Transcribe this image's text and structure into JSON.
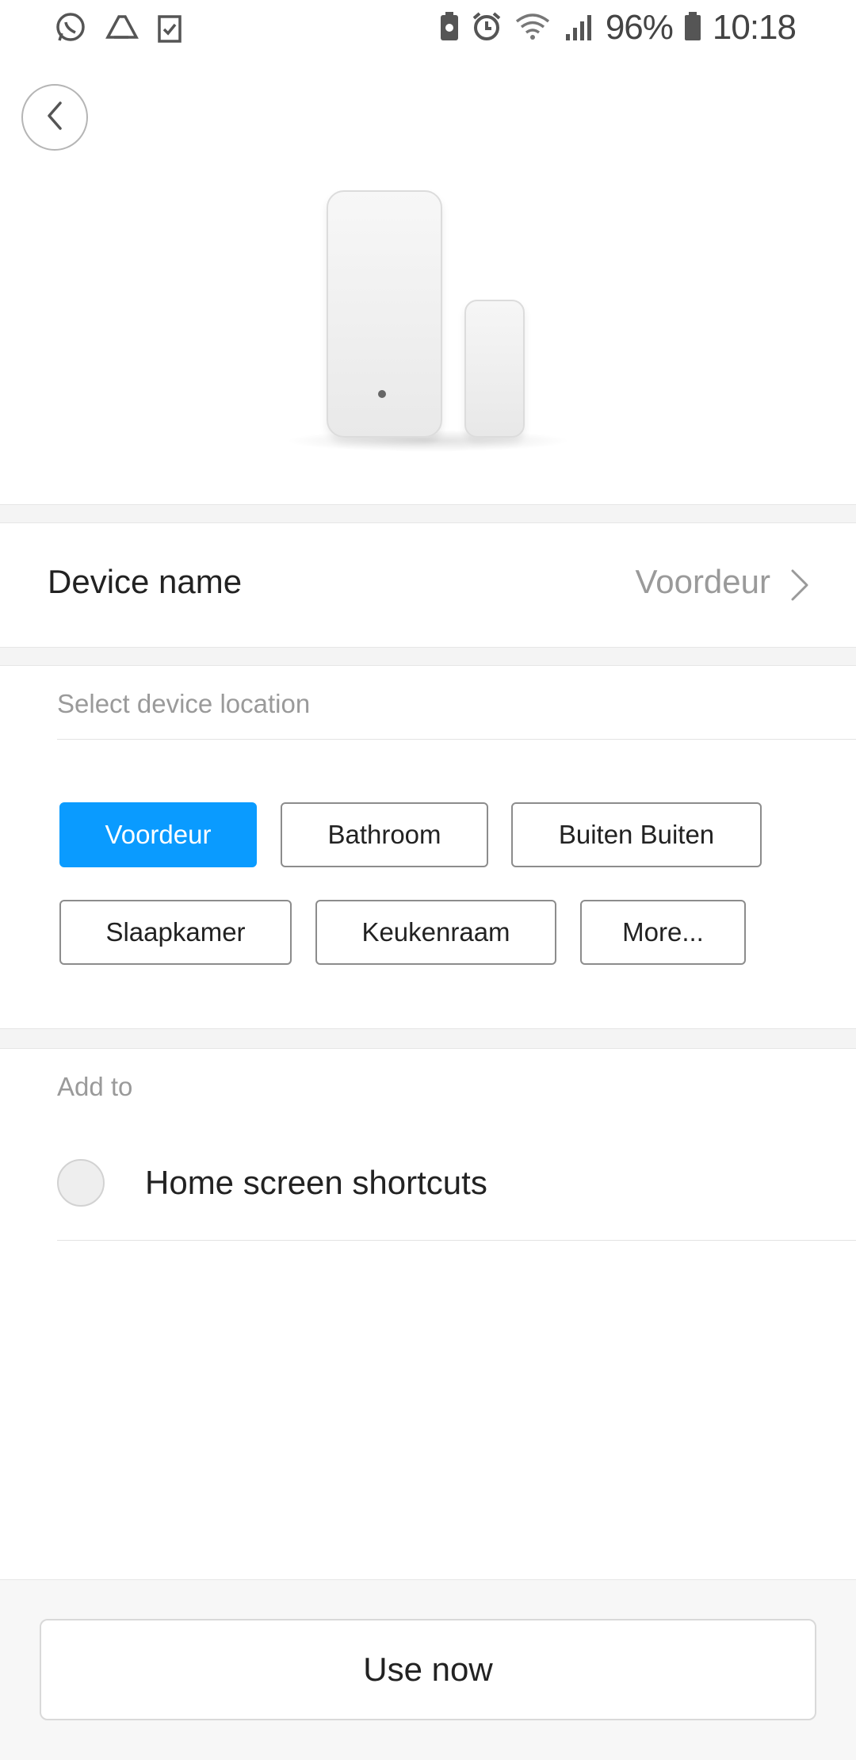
{
  "status_bar": {
    "battery": "96%",
    "time": "10:18",
    "left_icons": [
      "whatsapp-icon",
      "drive-icon",
      "clipboard-check-icon"
    ],
    "right_icons": [
      "battery-saver-icon",
      "alarm-icon",
      "wifi-icon",
      "signal-icon",
      "battery-icon"
    ]
  },
  "header": {
    "back_icon": "chevron-left-icon"
  },
  "device_name": {
    "label": "Device name",
    "value": "Voordeur"
  },
  "location": {
    "title": "Select device location",
    "chips": [
      {
        "label": "Voordeur",
        "selected": true
      },
      {
        "label": "Bathroom",
        "selected": false
      },
      {
        "label": "Buiten Buiten",
        "selected": false
      },
      {
        "label": "Slaapkamer",
        "selected": false
      },
      {
        "label": "Keukenraam",
        "selected": false
      },
      {
        "label": "More...",
        "selected": false
      }
    ]
  },
  "add_to": {
    "title": "Add to",
    "shortcut_label": "Home screen shortcuts",
    "checked": false
  },
  "footer": {
    "use_now_label": "Use now"
  },
  "colors": {
    "accent": "#0a9bff",
    "muted_text": "#9a9a9a",
    "divider": "#f4f4f4"
  }
}
